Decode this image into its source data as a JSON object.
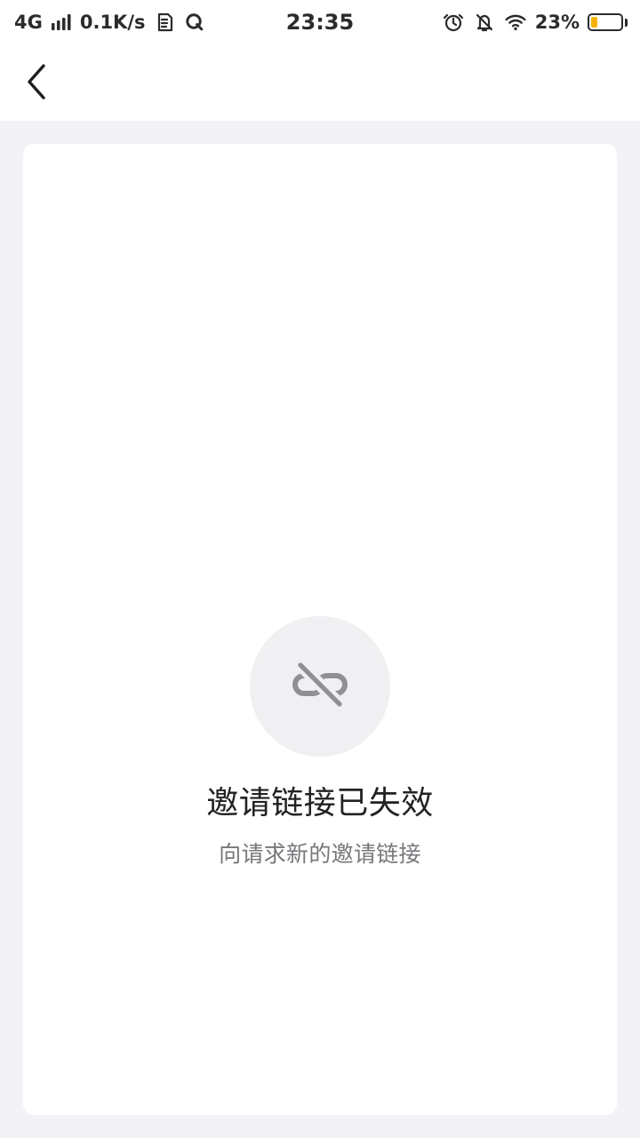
{
  "status_bar": {
    "network": "4G",
    "speed": "0.1K/s",
    "time": "23:35",
    "battery_percent_text": "23%",
    "battery_level": 0.23,
    "icons": [
      "signal-icon",
      "sd-icon",
      "q-app-icon",
      "alarm-icon",
      "silent-icon",
      "wifi-icon",
      "battery-icon"
    ]
  },
  "header": {
    "back_icon": "back-chevron-icon"
  },
  "empty_state": {
    "icon": "broken-link-icon",
    "title": "邀请链接已失效",
    "subtitle": "向请求新的邀请链接"
  },
  "colors": {
    "background": "#f3f3f7",
    "card": "#ffffff",
    "icon_circle": "#f0f0f3",
    "icon": "#8f9096",
    "title": "#222222",
    "subtitle": "#77777c",
    "battery_fill": "#f5b300"
  }
}
